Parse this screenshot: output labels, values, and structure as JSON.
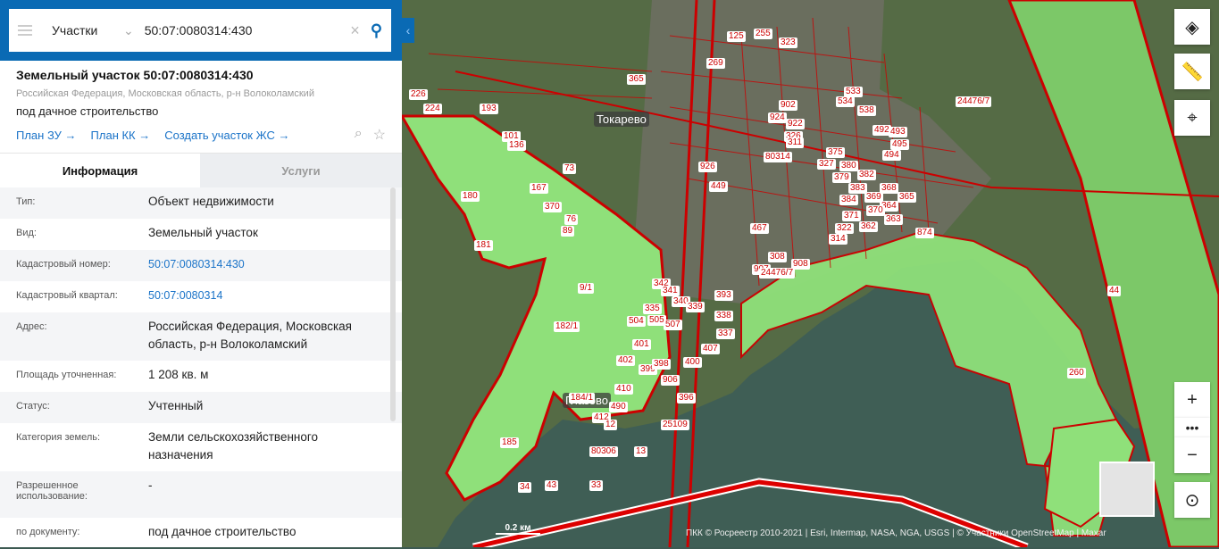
{
  "search": {
    "layer": "Участки",
    "query": "50:07:0080314:430"
  },
  "card": {
    "title": "Земельный участок 50:07:0080314:430",
    "address": "Российская Федерация, Московская область, р-н Волоколамский",
    "use": "под дачное строительство",
    "links": [
      "План ЗУ →",
      "План КК →",
      "Создать участок ЖС →"
    ]
  },
  "tabs": {
    "info": "Информация",
    "services": "Услуги"
  },
  "rows": [
    {
      "k": "Тип:",
      "v": "Объект недвижимости"
    },
    {
      "k": "Вид:",
      "v": "Земельный участок"
    },
    {
      "k": "Кадастровый номер:",
      "v": "50:07:0080314:430"
    },
    {
      "k": "Кадастровый квартал:",
      "v": "50:07:0080314"
    },
    {
      "k": "Адрес:",
      "v": "Российская Федерация, Московская область, р-н Волоколамский"
    },
    {
      "k": "Площадь уточненная:",
      "v": "1 208 кв. м"
    },
    {
      "k": "Статус:",
      "v": "Учтенный"
    },
    {
      "k": "Категория земель:",
      "v": "Земли сельскохозяйственного назначения"
    },
    {
      "k": "Разрешенное использование:",
      "v": "-"
    },
    {
      "k": "по документу:",
      "v": "под дачное строительство"
    }
  ],
  "map": {
    "places": [
      "Токарево",
      "Глазово"
    ],
    "parcels": [
      "125",
      "255",
      "323",
      "269",
      "365",
      "226",
      "224",
      "193",
      "101",
      "136",
      "73",
      "167",
      "370",
      "76",
      "89",
      "180",
      "181",
      "9/1",
      "182/1",
      "533",
      "534",
      "538",
      "492",
      "493",
      "495",
      "494",
      "24476/7",
      "902",
      "924",
      "922",
      "326",
      "311",
      "80314",
      "926",
      "449",
      "375",
      "380",
      "382",
      "327",
      "379",
      "383",
      "368",
      "365",
      "369",
      "364",
      "370",
      "363",
      "384",
      "371",
      "362",
      "322",
      "314",
      "874",
      "467",
      "907",
      "308",
      "908",
      "342",
      "341",
      "340",
      "335",
      "504",
      "505",
      "339",
      "393",
      "338",
      "337",
      "507",
      "407",
      "401",
      "402",
      "399",
      "398",
      "400",
      "906",
      "410",
      "396",
      "25109",
      "184/1",
      "490",
      "412",
      "12",
      "13",
      "185",
      "80306",
      "34",
      "43",
      "33",
      "44",
      "260",
      "24476/7"
    ],
    "scale": "0.2 км",
    "attribution": "ПКК © Росреестр 2010-2021 | Esri, Intermap, NASA, NGA, USGS | © Участники OpenStreetMap | Maxar"
  }
}
